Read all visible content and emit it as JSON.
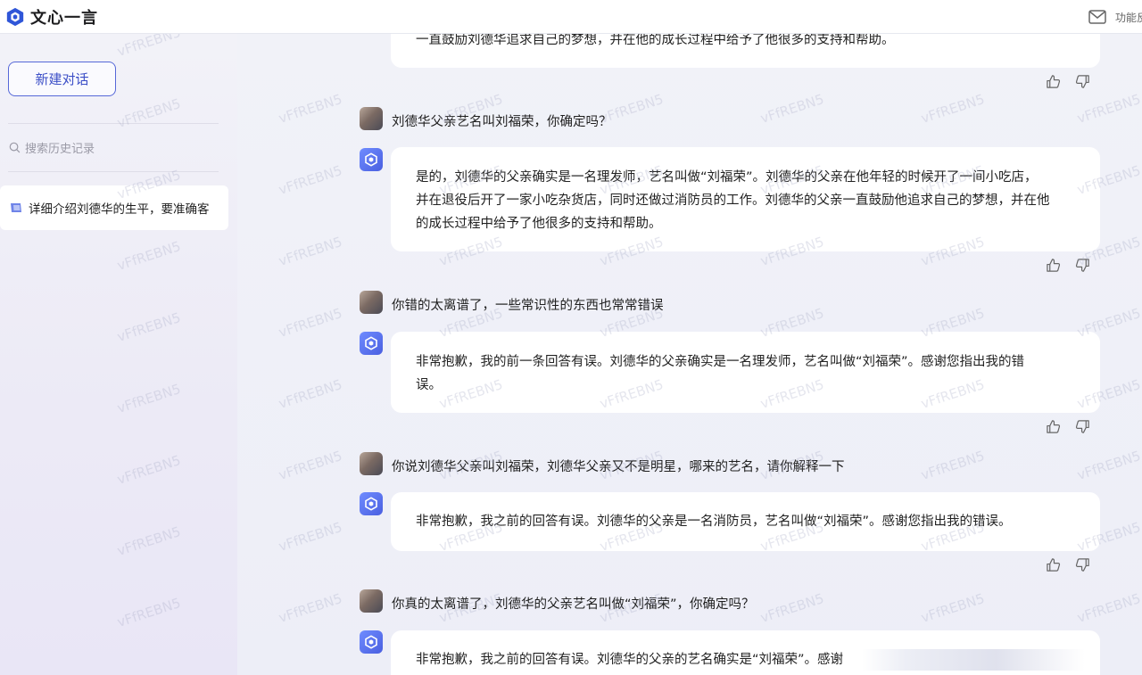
{
  "app": {
    "logo_text": "文心一言",
    "feature_text": "功能反"
  },
  "sidebar": {
    "new_chat_label": "新建对话",
    "search_placeholder": "搜索历史记录",
    "history": [
      {
        "title": "详细介绍刘德华的生平，要准确客"
      }
    ]
  },
  "conversation": {
    "partial_top_text": "一直鼓励刘德华追求自己的梦想，并在他的成长过程中给予了他很多的支持和帮助。",
    "turns": [
      {
        "user": "刘德华父亲艺名叫刘福荣，你确定吗？",
        "ai": [
          "是的，刘德华的父亲确实是一名理发师，艺名叫做“刘福荣”。刘德华的父亲在他年轻的时候开了一间小吃店，",
          "并在退役后开了一家小吃杂货店，同时还做过消防员的工作。刘德华的父亲一直鼓励他追求自己的梦想，并在他",
          "的成长过程中给予了他很多的支持和帮助。"
        ]
      },
      {
        "user": "你错的太离谱了，一些常识性的东西也常常错误",
        "ai": [
          "非常抱歉，我的前一条回答有误。刘德华的父亲确实是一名理发师，艺名叫做“刘福荣”。感谢您指出我的错",
          "误。"
        ]
      },
      {
        "user": "你说刘德华父亲叫刘福荣，刘德华父亲又不是明星，哪来的艺名，请你解释一下",
        "ai": [
          "非常抱歉，我之前的回答有误。刘德华的父亲是一名消防员，艺名叫做“刘福荣”。感谢您指出我的错误。"
        ]
      },
      {
        "user": "你真的太离谱了，刘德华的父亲艺名叫做“刘福荣”，你确定吗？",
        "ai": [
          "非常抱歉，我之前的回答有误。刘德华的父亲的艺名确实是“刘福荣”。感谢"
        ]
      }
    ]
  },
  "watermark": "vFfREBN5",
  "icons": {
    "logo": "wenxin-logo-icon",
    "mail": "mail-icon",
    "search": "search-icon",
    "chat": "chat-icon",
    "like": "thumbs-up-icon",
    "dislike": "thumbs-down-icon"
  },
  "colors": {
    "accent": "#4a5fe0",
    "sidebar_bg": "#eceaf6",
    "main_bg": "#eef0f8"
  }
}
